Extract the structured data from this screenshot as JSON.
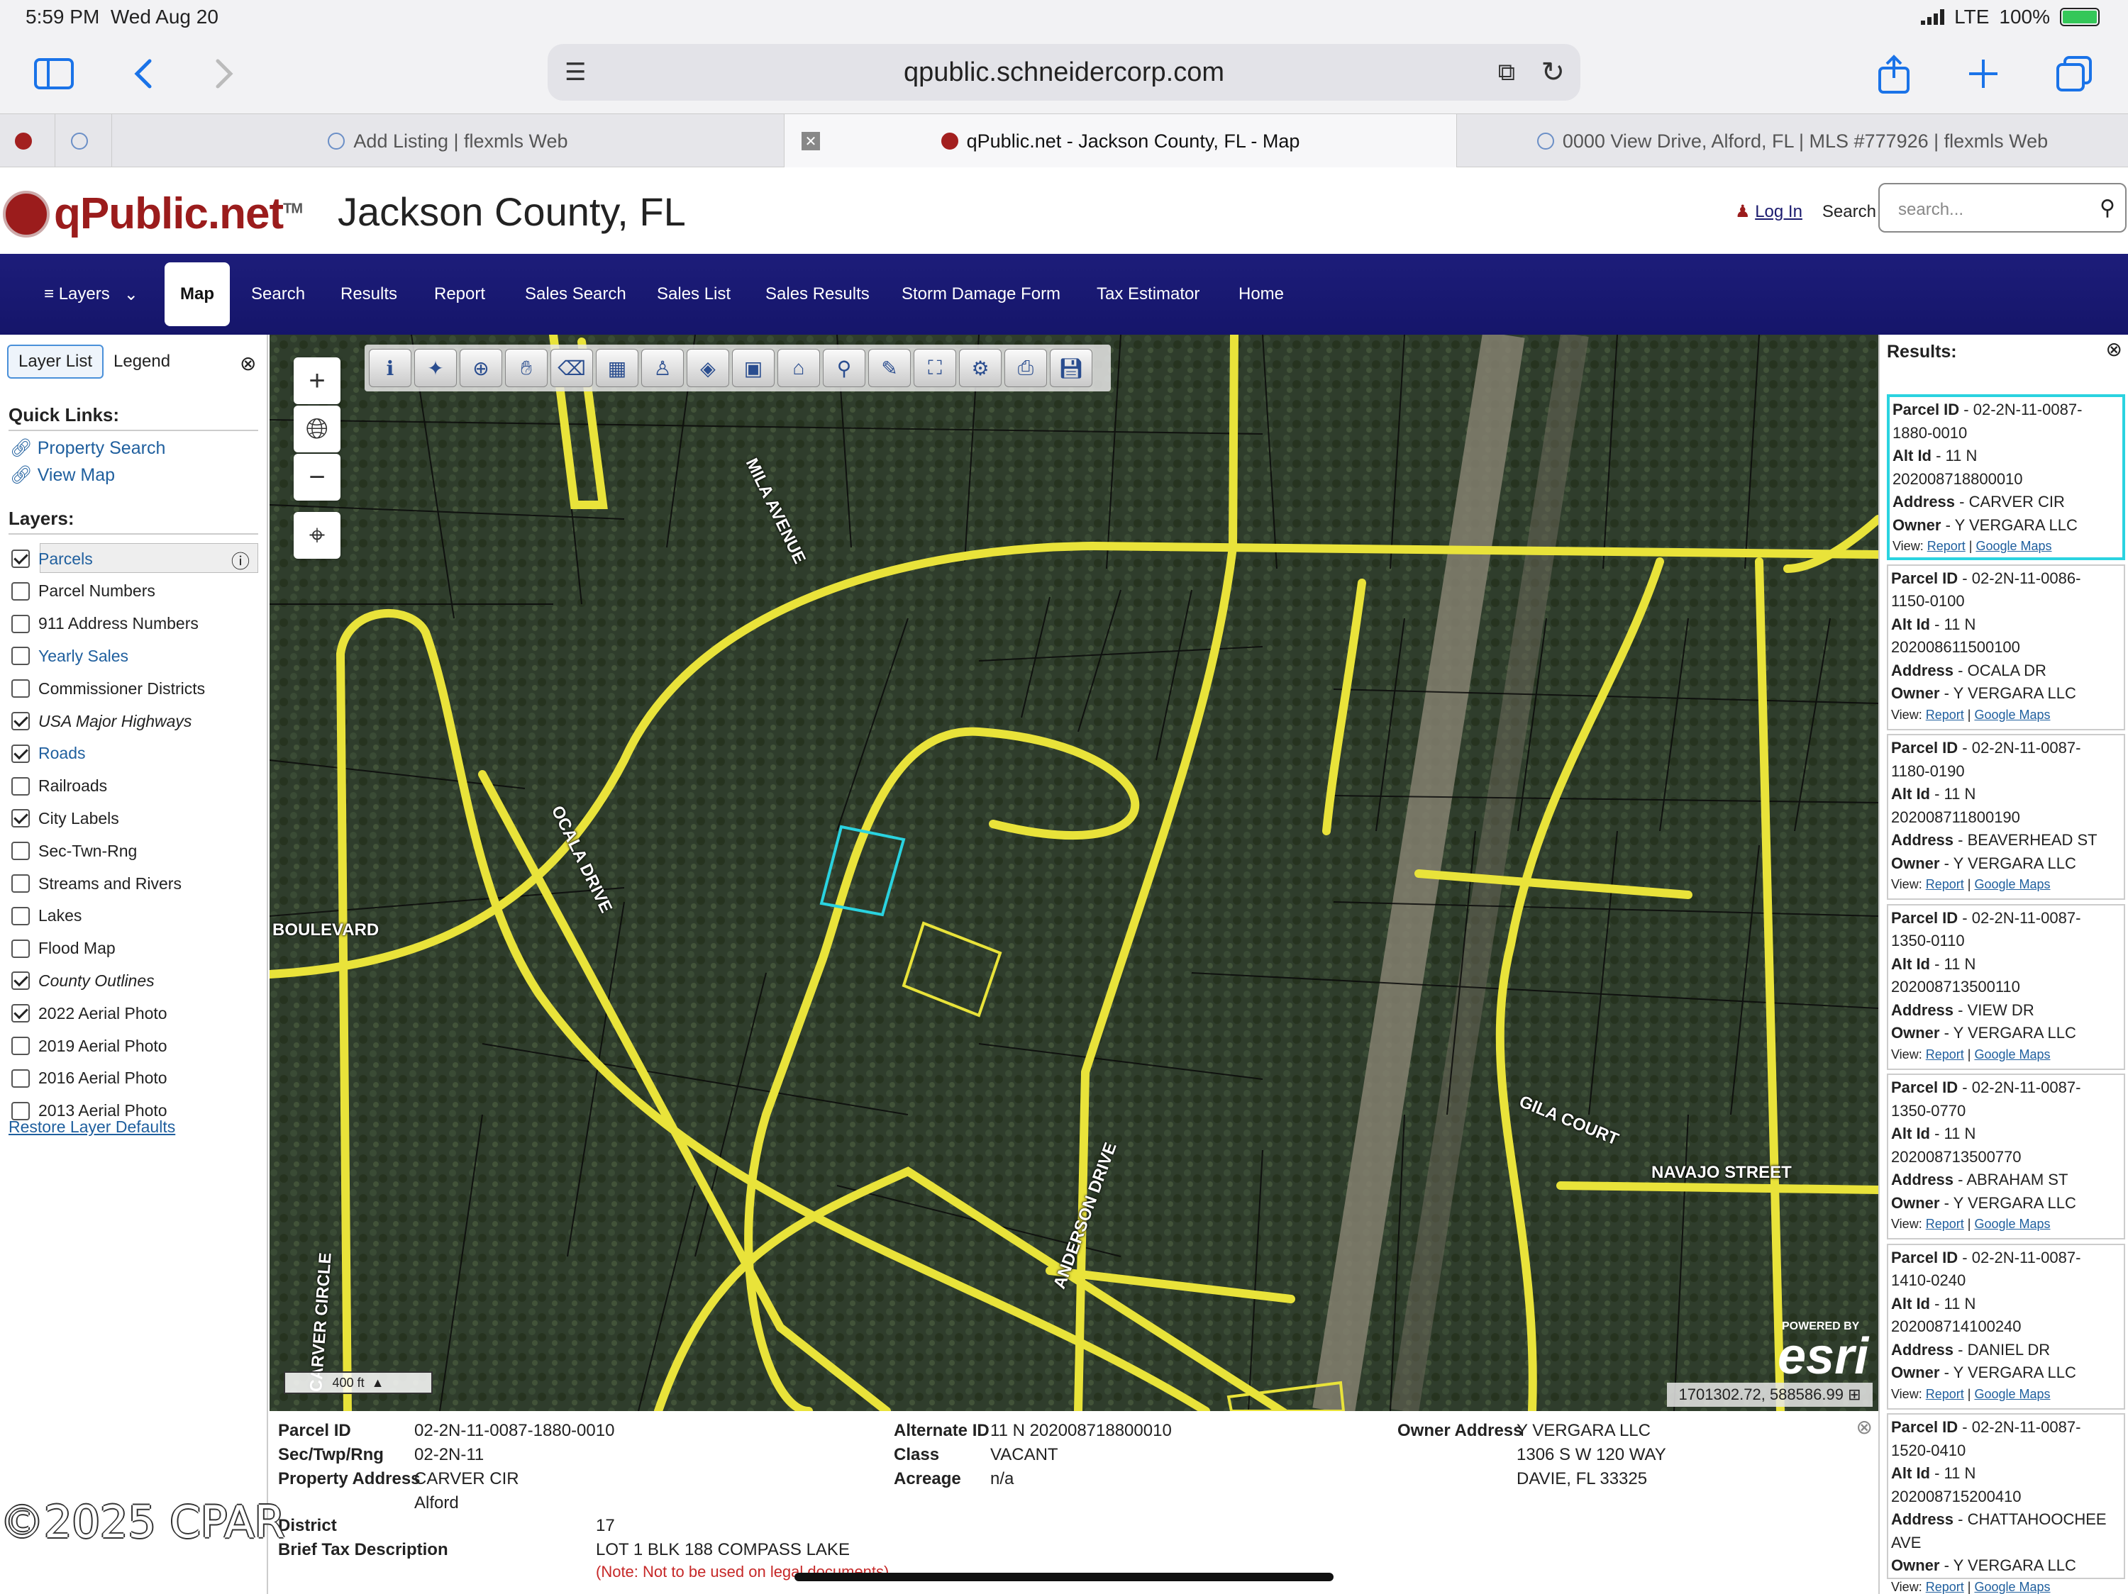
{
  "status_bar": {
    "time": "5:59 PM",
    "date": "Wed Aug 20",
    "network": "LTE",
    "battery": "100%"
  },
  "browser": {
    "url": "qpublic.schneidercorp.com"
  },
  "tabs": [
    {
      "label": "Add Listing | flexmls Web"
    },
    {
      "label": "qPublic.net - Jackson County, FL - Map"
    },
    {
      "label": "0000 View Drive, Alford, FL | MLS #777926 | flexmls Web"
    }
  ],
  "header": {
    "brand": "qPublic.net",
    "tm": "TM",
    "county": "Jackson County, FL",
    "login": "Log In",
    "search_label": "Search",
    "search_placeholder": "search..."
  },
  "nav": [
    "Layers",
    "Map",
    "Search",
    "Results",
    "Report",
    "Sales Search",
    "Sales List",
    "Sales Results",
    "Storm Damage Form",
    "Tax Estimator",
    "Home"
  ],
  "left_panel": {
    "tabs": [
      "Layer List",
      "Legend"
    ],
    "quick_links_title": "Quick Links:",
    "quick_links": [
      "Property Search",
      "View Map"
    ],
    "layers_title": "Layers:",
    "layers": [
      {
        "label": "Parcels",
        "checked": true
      },
      {
        "label": "Parcel Numbers",
        "checked": false
      },
      {
        "label": "911 Address Numbers",
        "checked": false
      },
      {
        "label": "Yearly Sales",
        "checked": false
      },
      {
        "label": "Commissioner Districts",
        "checked": false
      },
      {
        "label": "USA Major Highways",
        "checked": true
      },
      {
        "label": "Roads",
        "checked": true
      },
      {
        "label": "Railroads",
        "checked": false
      },
      {
        "label": "City Labels",
        "checked": true
      },
      {
        "label": "Sec-Twn-Rng",
        "checked": false
      },
      {
        "label": "Streams and Rivers",
        "checked": false
      },
      {
        "label": "Lakes",
        "checked": false
      },
      {
        "label": "Flood Map",
        "checked": false
      },
      {
        "label": "County Outlines",
        "checked": true
      },
      {
        "label": "2022 Aerial Photo",
        "checked": true
      },
      {
        "label": "2019 Aerial Photo",
        "checked": false
      },
      {
        "label": "2016 Aerial Photo",
        "checked": false
      },
      {
        "label": "2013 Aerial Photo",
        "checked": false
      }
    ],
    "restore": "Restore Layer Defaults"
  },
  "map": {
    "road_labels": [
      "MILA AVENUE",
      "OCALA DRIVE",
      "BOULEVARD",
      "ANDERSON DRIVE",
      "CARVER CIRCLE",
      "GILA COURT",
      "NAVAJO STREET"
    ],
    "scale": "400 ft",
    "coordinates": "1701302.72, 588586.99",
    "esri": "esri",
    "esri_powered": "POWERED BY"
  },
  "info": {
    "labels": {
      "parcel_id": "Parcel ID",
      "str": "Sec/Twp/Rng",
      "address": "Property Address",
      "district": "District",
      "brief": "Brief Tax Description",
      "alt_id": "Alternate ID",
      "class": "Class",
      "acreage": "Acreage",
      "owner_address": "Owner Address"
    },
    "parcel_id": "02-2N-11-0087-1880-0010",
    "str": "02-2N-11",
    "address_line1": "CARVER CIR",
    "address_line2": "Alford",
    "district": "17",
    "brief": "LOT 1 BLK 188 COMPASS LAKE",
    "note": "(Note: Not to be used on legal documents)",
    "alt_id": "11 N 202008718800010",
    "class": "VACANT",
    "acreage": "n/a",
    "owner_line1": "Y VERGARA LLC",
    "owner_line2": "1306 S W 120 WAY",
    "owner_line3": "DAVIE, FL 33325"
  },
  "results": {
    "title": "Results:",
    "labels": {
      "parcel": "Parcel ID",
      "alt": "Alt Id",
      "address": "Address",
      "owner": "Owner",
      "view": "View:",
      "report": "Report",
      "gmaps": "Google Maps"
    },
    "items": [
      {
        "pid1": " - 02-2N-11-0087-",
        "pid2": "1880-0010",
        "alt1": " - 11 N",
        "alt2": "202008718800010",
        "addr": " - CARVER CIR",
        "owner": " - Y VERGARA LLC"
      },
      {
        "pid1": " - 02-2N-11-0086-",
        "pid2": "1150-0100",
        "alt1": " - 11 N",
        "alt2": "202008611500100",
        "addr": " - OCALA DR",
        "owner": " - Y VERGARA LLC"
      },
      {
        "pid1": " - 02-2N-11-0087-",
        "pid2": "1180-0190",
        "alt1": " - 11 N",
        "alt2": "202008711800190",
        "addr": " - BEAVERHEAD ST",
        "owner": " - Y VERGARA LLC"
      },
      {
        "pid1": " - 02-2N-11-0087-",
        "pid2": "1350-0110",
        "alt1": " - 11 N",
        "alt2": "202008713500110",
        "addr": " - VIEW DR",
        "owner": " - Y VERGARA LLC"
      },
      {
        "pid1": " - 02-2N-11-0087-",
        "pid2": "1350-0770",
        "alt1": " - 11 N",
        "alt2": "202008713500770",
        "addr": " - ABRAHAM ST",
        "owner": " - Y VERGARA LLC"
      },
      {
        "pid1": " - 02-2N-11-0087-",
        "pid2": "1410-0240",
        "alt1": " - 11 N",
        "alt2": "202008714100240",
        "addr": " - DANIEL DR",
        "owner": " - Y VERGARA LLC"
      },
      {
        "pid1": " - 02-2N-11-0087-",
        "pid2": "1520-0410",
        "alt1": " - 11 N",
        "alt2": "202008715200410",
        "addr": " - CHATTAHOOCHEE",
        "addr2": "AVE",
        "owner": " - Y VERGARA LLC"
      }
    ]
  },
  "watermark": "©2025 CPAR"
}
